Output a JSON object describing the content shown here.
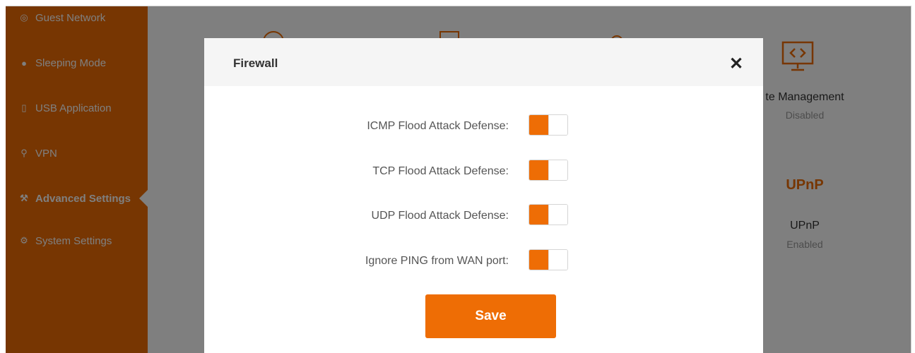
{
  "colors": {
    "accent": "#ee6d05",
    "overlay": "rgba(0,0,0,0.5)",
    "muted": "#999999"
  },
  "sidebar": {
    "items": [
      {
        "icon": "guest-network-icon",
        "label": "Guest Network",
        "active": false
      },
      {
        "icon": "sleeping-mode-icon",
        "label": "Sleeping Mode",
        "active": false
      },
      {
        "icon": "usb-icon",
        "label": "USB Application",
        "active": false
      },
      {
        "icon": "vpn-icon",
        "label": "VPN",
        "active": false
      },
      {
        "icon": "wrench-icon",
        "label": "Advanced Settings",
        "active": true
      },
      {
        "icon": "gear-icon",
        "label": "System Settings",
        "active": false
      }
    ]
  },
  "background_tiles": [
    {
      "icon": "remote-management-icon",
      "title": "te Management",
      "status": "Disabled"
    },
    {
      "icon": "upnp-icon",
      "icon_text": "UPnP",
      "title": "UPnP",
      "status": "Enabled"
    }
  ],
  "modal": {
    "title": "Firewall",
    "close_glyph": "✕",
    "settings": [
      {
        "label": "ICMP Flood Attack Defense:",
        "enabled": true
      },
      {
        "label": "TCP Flood Attack Defense:",
        "enabled": true
      },
      {
        "label": "UDP Flood Attack Defense:",
        "enabled": true
      },
      {
        "label": "Ignore PING from WAN port:",
        "enabled": true
      }
    ],
    "save_label": "Save"
  }
}
